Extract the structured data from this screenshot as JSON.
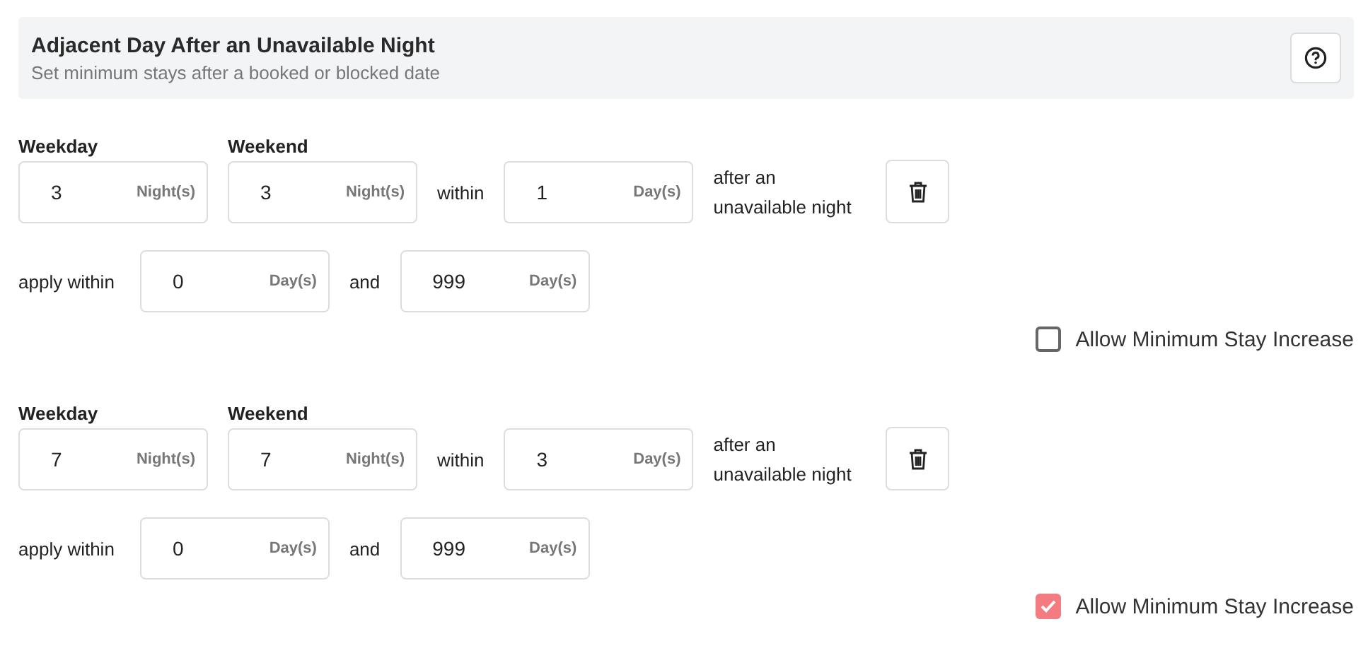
{
  "header": {
    "title": "Adjacent Day After an Unavailable Night",
    "subtitle": "Set minimum stays after a booked or blocked date"
  },
  "rules": [
    {
      "weekday": {
        "label": "Weekday",
        "value": "3",
        "unit": "Night(s)"
      },
      "weekend": {
        "label": "Weekend",
        "value": "3",
        "unit": "Night(s)"
      },
      "within_label": "within",
      "within": {
        "value": "1",
        "unit": "Day(s)"
      },
      "after_text": "after an unavailable night",
      "apply_label": "apply within",
      "apply_from": {
        "value": "0",
        "unit": "Day(s)"
      },
      "and_label": "and",
      "apply_to": {
        "value": "999",
        "unit": "Day(s)"
      },
      "increase": {
        "label": "Allow Minimum Stay Increase",
        "checked": false
      }
    },
    {
      "weekday": {
        "label": "Weekday",
        "value": "7",
        "unit": "Night(s)"
      },
      "weekend": {
        "label": "Weekend",
        "value": "7",
        "unit": "Night(s)"
      },
      "within_label": "within",
      "within": {
        "value": "3",
        "unit": "Day(s)"
      },
      "after_text": "after an unavailable night",
      "apply_label": "apply within",
      "apply_from": {
        "value": "0",
        "unit": "Day(s)"
      },
      "and_label": "and",
      "apply_to": {
        "value": "999",
        "unit": "Day(s)"
      },
      "increase": {
        "label": "Allow Minimum Stay Increase",
        "checked": true
      }
    }
  ]
}
